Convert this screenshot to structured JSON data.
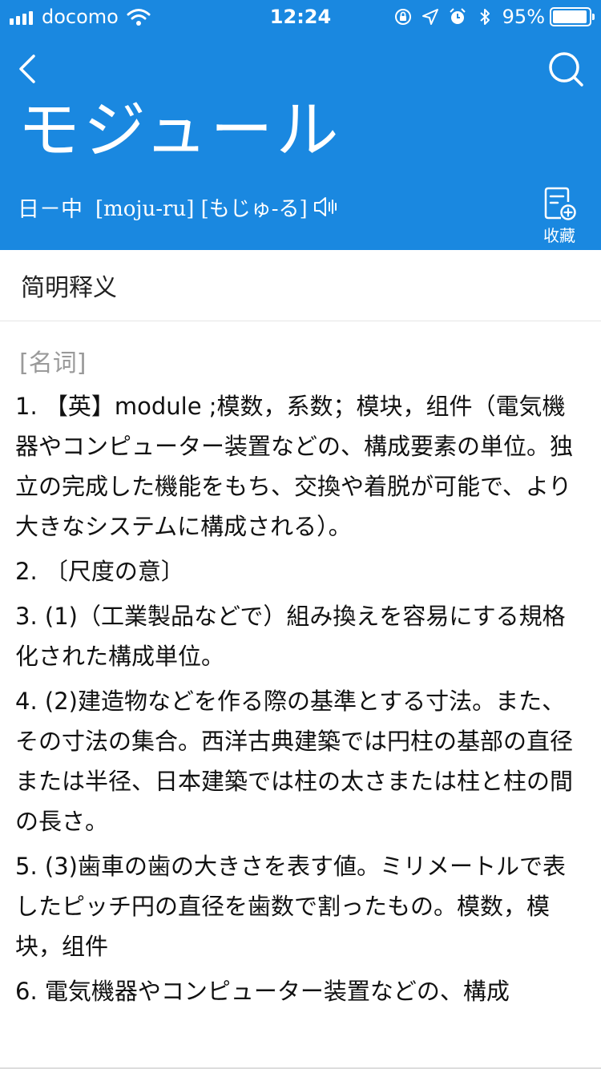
{
  "status_bar": {
    "carrier": "docomo",
    "time": "12:24",
    "battery_percent_text": "95%",
    "battery_level": 0.95,
    "icons": [
      "signal-icon",
      "wifi-icon",
      "rotation-lock-icon",
      "location-icon",
      "alarm-icon",
      "bluetooth-icon",
      "battery-icon"
    ]
  },
  "header": {
    "background_color": "#1a88e0",
    "headword": "モジュール",
    "dictionary_direction": "日－中",
    "pronunciation": "[moju-ru] [もじゅ-る]",
    "collect_label": "收藏",
    "icons": [
      "back-icon",
      "search-icon",
      "speaker-icon",
      "collect-icon"
    ]
  },
  "section": {
    "title": "简明释义"
  },
  "entry": {
    "part_of_speech": "[名词]",
    "definitions": [
      "1. 【英】module ;模数，系数；模块，组件（電気機器やコンピューター装置などの、構成要素の単位。独立の完成した機能をもち、交換や着脱が可能で、より大きなシステムに構成される）。",
      "2. 〔尺度の意〕",
      "3. (1)（工業製品などで）組み換えを容易にする規格化された構成単位。",
      "4. (2)建造物などを作る際の基準とする寸法。また、その寸法の集合。西洋古典建築では円柱の基部の直径または半径、日本建築では柱の太さまたは柱と柱の間の長さ。",
      "5. (3)歯車の歯の大きさを表す値。ミリメートルで表したピッチ円の直径を歯数で割ったもの。模数，模块，组件",
      "6. 電気機器やコンピューター装置などの、構成"
    ]
  }
}
